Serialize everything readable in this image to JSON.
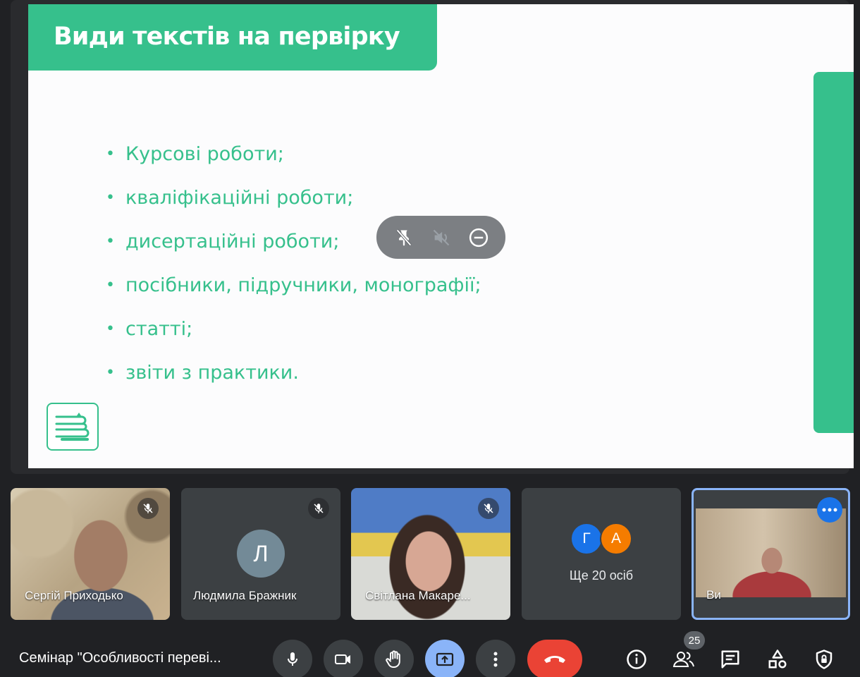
{
  "slide": {
    "title": "Види текстів на первірку",
    "bullet_symbol": "•",
    "items": [
      "Курсові роботи;",
      "кваліфікаційні роботи;",
      "дисертаційні роботи;",
      "посібники,  підручники, монографії;",
      "статті;",
      "звіти з практики."
    ],
    "accent_color": "#36c08c",
    "logo_icon": "books-stack-icon"
  },
  "overlay_controls": {
    "buttons": [
      "unpin-icon",
      "mute-audio-icon",
      "remove-icon"
    ]
  },
  "participants": [
    {
      "name": "Сергій Приходько",
      "muted": true,
      "video": true
    },
    {
      "name": "Людмила Бражник",
      "initial": "Л",
      "muted": true,
      "video": false
    },
    {
      "name": "Світлана Макаре...",
      "muted": true,
      "video": true
    },
    {
      "others": {
        "initials": [
          "Г",
          "А"
        ],
        "colors": [
          "#1a73e8",
          "#f57c00"
        ],
        "label": "Ще 20 осіб"
      }
    },
    {
      "name": "Ви",
      "self": true,
      "video": true
    }
  ],
  "meeting": {
    "title": "Семінар \"Особливості переві..."
  },
  "controls": {
    "buttons": [
      "microphone-icon",
      "camera-icon",
      "raise-hand-icon",
      "present-screen-icon",
      "more-options-icon",
      "end-call-icon"
    ],
    "right": [
      "info-icon",
      "people-icon",
      "chat-icon",
      "activities-icon",
      "host-controls-icon"
    ],
    "participant_count": "25"
  }
}
